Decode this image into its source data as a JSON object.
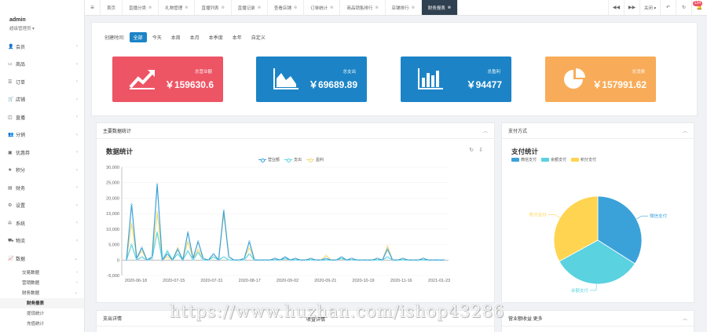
{
  "user": {
    "name": "admin",
    "role": "超级管理员 ▾"
  },
  "sidebar": {
    "items": [
      {
        "icon": "👤",
        "icon_name": "user-icon",
        "label": "会员"
      },
      {
        "icon": "▭",
        "icon_name": "goods-icon",
        "label": "商品"
      },
      {
        "icon": "☰",
        "icon_name": "order-icon",
        "label": "订单"
      },
      {
        "icon": "🛒",
        "icon_name": "cart-icon",
        "label": "店铺"
      },
      {
        "icon": "◫",
        "icon_name": "live-icon",
        "label": "直播"
      },
      {
        "icon": "👥",
        "icon_name": "distribution-icon",
        "label": "分销"
      },
      {
        "icon": "▣",
        "icon_name": "coupon-icon",
        "label": "优惠券"
      },
      {
        "icon": "★",
        "icon_name": "points-icon",
        "label": "积分"
      },
      {
        "icon": "▤",
        "icon_name": "finance-icon",
        "label": "财务"
      },
      {
        "icon": "⚙",
        "icon_name": "settings-icon",
        "label": "设置"
      },
      {
        "icon": "✇",
        "icon_name": "system-icon",
        "label": "系统"
      },
      {
        "icon": "⛟",
        "icon_name": "logistics-icon",
        "label": "物流"
      },
      {
        "icon": "📈",
        "icon_name": "data-icon",
        "label": "数据"
      }
    ],
    "sub_items": [
      "交易数据",
      "营销数据",
      "财务数据"
    ],
    "sub2_items": [
      "财务报表",
      "提现统计",
      "充值统计"
    ]
  },
  "tabs": {
    "items": [
      "首页",
      "直播分类",
      "礼物管理",
      "直播列表",
      "直播记录",
      "查看店铺",
      "订单统计",
      "商品销售排行",
      "店铺排行",
      "财务报表"
    ],
    "controls": {
      "prev": "◀◀",
      "next": "▶▶",
      "close": "关闭 ▾",
      "back": "↶",
      "refresh": "↻",
      "notify_count": "134"
    }
  },
  "filter": {
    "label": "创建时间:",
    "options": [
      "全部",
      "今天",
      "本周",
      "本月",
      "本季度",
      "本年",
      "自定义"
    ]
  },
  "cards": [
    {
      "label": "总营业额",
      "value": "￥159630.6",
      "color": "#ed5565",
      "icon": "trend-icon"
    },
    {
      "label": "总支出",
      "value": "￥69689.89",
      "color": "#1c84c6",
      "icon": "area-chart-icon"
    },
    {
      "label": "总盈利",
      "value": "￥94477",
      "color": "#1c84c6",
      "icon": "bar-chart-icon"
    },
    {
      "label": "总消费",
      "value": "￥157991.62",
      "color": "#f8ac59",
      "icon": "pie-chart-icon"
    }
  ],
  "panels": {
    "main_title": "主要数据统计",
    "pay_title": "支付方式",
    "bottom_left": "支出详情",
    "bottom_middle": "收益详情",
    "bottom_right": "营业额收益 更多"
  },
  "chart_data": [
    {
      "type": "line",
      "title": "数据统计",
      "legend_position": "top",
      "x_ticks": [
        "2020-06-18",
        "2020-07-15",
        "2020-07-31",
        "2020-08-17",
        "2020-09-02",
        "2020-09-21",
        "2020-10-19",
        "2020-11-16",
        "2021-01-23"
      ],
      "ylim": [
        -5000,
        30000
      ],
      "y_ticks": [
        "30,000",
        "25,000",
        "20,000",
        "15,000",
        "10,000",
        "5,000",
        "0",
        "-5,000"
      ],
      "series": [
        {
          "name": "营业额",
          "color": "#3ba1d9",
          "values": [
            0,
            18000,
            500,
            4000,
            0,
            1000,
            24500,
            0,
            2000,
            0,
            3500,
            0,
            9000,
            500,
            6000,
            500,
            0,
            2000,
            0,
            16000,
            1000,
            0,
            0,
            500,
            6000,
            0,
            0,
            0,
            0,
            500,
            0,
            1000,
            0,
            500,
            0,
            0,
            500,
            0,
            0,
            500,
            0,
            0,
            1000,
            0,
            500,
            0,
            0,
            0,
            0,
            500,
            0,
            3500,
            0,
            0,
            500,
            0,
            0,
            0,
            500,
            0,
            0,
            0,
            0
          ]
        },
        {
          "name": "支出",
          "color": "#5ad2e0",
          "values": [
            0,
            5000,
            0,
            1000,
            0,
            500,
            9000,
            0,
            3000,
            0,
            2000,
            0,
            3000,
            0,
            2500,
            0,
            0,
            1000,
            0,
            1000,
            0,
            0,
            0,
            0,
            2000,
            0,
            0,
            0,
            0,
            0,
            0,
            500,
            0,
            0,
            0,
            0,
            0,
            0,
            0,
            0,
            0,
            0,
            500,
            0,
            0,
            0,
            0,
            0,
            0,
            0,
            0,
            1000,
            0,
            0,
            0,
            0,
            0,
            0,
            0,
            0,
            0,
            0,
            0
          ]
        },
        {
          "name": "盈利",
          "color": "#f0d879",
          "values": [
            0,
            12000,
            500,
            3000,
            0,
            500,
            15500,
            0,
            1000,
            0,
            4000,
            0,
            6000,
            500,
            3500,
            500,
            0,
            1000,
            0,
            15000,
            1000,
            0,
            0,
            500,
            4000,
            0,
            0,
            0,
            0,
            500,
            0,
            500,
            0,
            500,
            0,
            0,
            500,
            0,
            0,
            1500,
            0,
            0,
            500,
            0,
            500,
            0,
            0,
            0,
            0,
            500,
            0,
            4500,
            0,
            0,
            500,
            0,
            0,
            0,
            500,
            0,
            0,
            0,
            0
          ]
        }
      ]
    },
    {
      "type": "pie",
      "title": "支付统计",
      "legend_position": "top",
      "slices": [
        {
          "name": "微信支付",
          "value": 34,
          "color": "#3ba1d9"
        },
        {
          "name": "余额支付",
          "value": 33,
          "color": "#5ad2e0"
        },
        {
          "name": "积分支付",
          "value": 33,
          "color": "#ffd451"
        }
      ]
    }
  ],
  "watermark": "https://www.huzhan.com/ishop43286"
}
